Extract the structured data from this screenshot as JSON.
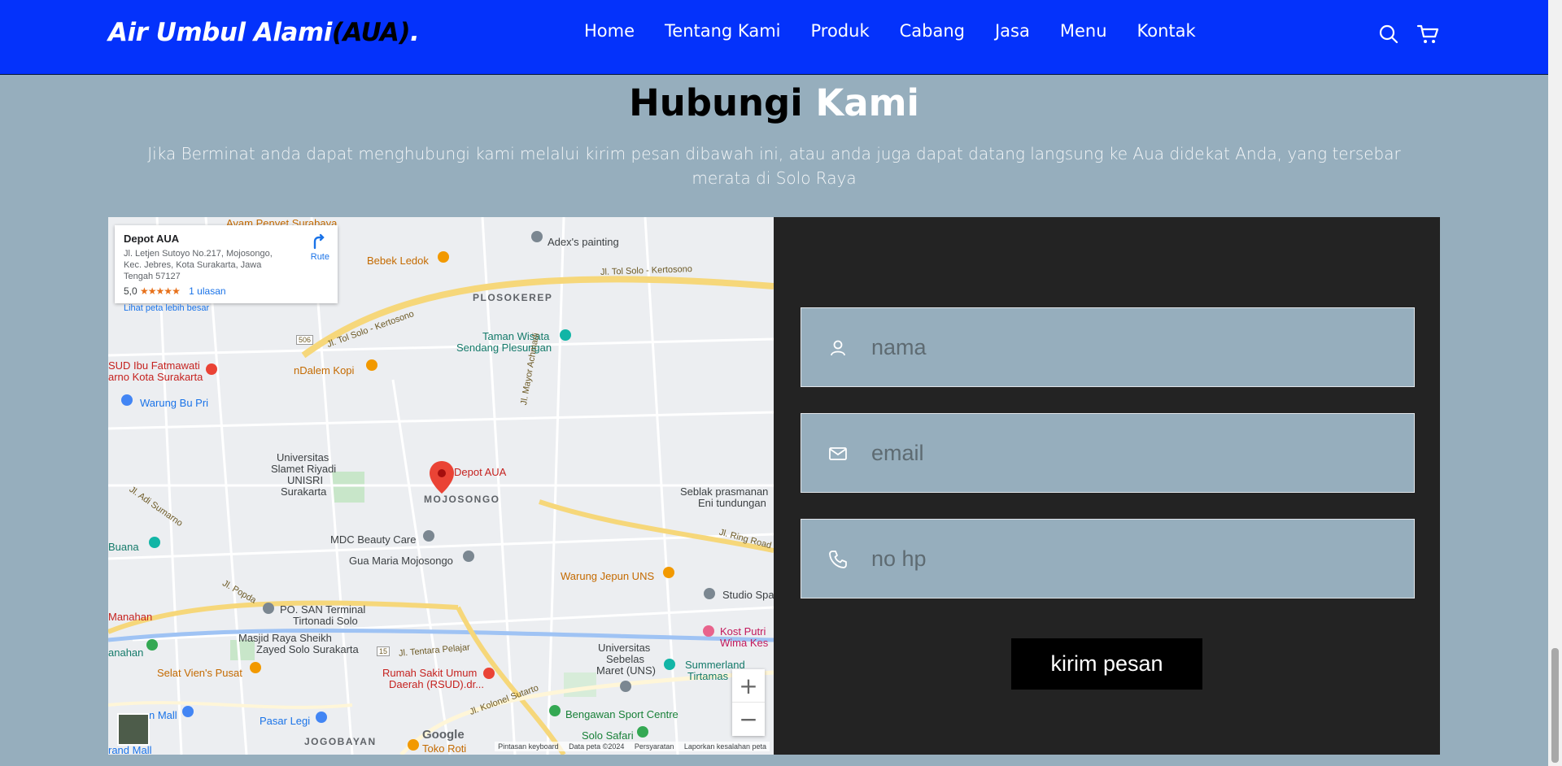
{
  "header": {
    "logo_main": "Air Umbul Alami",
    "logo_accent": "(AUA)",
    "logo_dot": ".",
    "nav": [
      "Home",
      "Tentang Kami",
      "Produk",
      "Cabang",
      "Jasa",
      "Menu",
      "Kontak"
    ],
    "icons": [
      "search-icon",
      "cart-icon"
    ]
  },
  "section": {
    "title_dark": "Hubungi",
    "title_light": "Kami",
    "description": "Jika Berminat anda dapat menghubungi kami melalui kirim pesan dibawah ini, atau anda juga dapat datang langsung ke Aua didekat Anda, yang tersebar merata di Solo Raya"
  },
  "map": {
    "place_name": "Depot AUA",
    "address": "Jl. Letjen Sutoyo No.217, Mojosongo, Kec. Jebres, Kota Surakarta, Jawa Tengah 57127",
    "rating": "5,0",
    "stars": "★★★★★",
    "reviews": "1 ulasan",
    "route_label": "Rute",
    "bigger_map": "Lihat peta lebih besar",
    "zoom_in": "+",
    "zoom_out": "−",
    "google": "Google",
    "attribution": [
      "Pintasan keyboard",
      "Data peta ©2024",
      "Persyaratan",
      "Laporkan kesalahan peta"
    ],
    "labels": {
      "ayam_penyet": "Ayam Penyet Surabaya",
      "adex": "Adex's painting",
      "bebek": "Bebek Ledok",
      "tol1": "Jl. Tol Solo - Kertosono",
      "plosokerep": "PLOSOKEREP",
      "tol2": "Jl. Tol Solo - Kertosono",
      "road506": "506",
      "taman": "Taman Wisata",
      "sendang": "Sendang Plesungan",
      "rsud_fatmawati": "SUD Ibu Fatmawati",
      "arno": "arno Kota Surakarta",
      "ndalem": "nDalem Kopi",
      "warung_bu": "Warung Bu Pri",
      "mayor": "Jl. Mayor Achmadi",
      "universitas1": "Universitas",
      "slamet": "Slamet Riyadi",
      "unisri": "UNISRI",
      "surakarta": "Surakarta",
      "depot_pin": "Depot AUA",
      "mojosongo": "MOJOSONGO",
      "seblak": "Seblak prasmanan",
      "eni": "Eni tundungan",
      "sumarno": "Jl. Adi Sumarno",
      "buana": "Buana",
      "mdc": "MDC Beauty Care",
      "gua_maria": "Gua Maria Mojosongo",
      "ring": "Jl. Ring Road",
      "warung_jepun": "Warung Jepun UNS",
      "studio": "Studio Spa",
      "popda": "Jl. Popda",
      "po_san": "PO. SAN Terminal",
      "tirtonadi": "Tirtonadi Solo",
      "manahan": "Manahan",
      "masjid": "Masjid Raya Sheikh",
      "zayed": "Zayed Solo Surakarta",
      "road15": "15",
      "tentara": "Jl. Tentara Pelajar",
      "universitas2": "Universitas",
      "sebelas": "Sebelas",
      "maret": "Maret (UNS)",
      "kost": "Kost Putri",
      "wima": "Wima Kes",
      "summerland": "Summerland",
      "tirtamas": "Tirtamas",
      "nahan": "anahan",
      "selat": "Selat Vien's Pusat",
      "rumah_sakit": "Rumah Sakit Umum",
      "daerah": "Daerah (RSUD).dr...",
      "kolonel": "Jl. Kolonel Sutarto",
      "bengawan": "Bengawan Sport Centre",
      "mall": "n Mall",
      "pasar": "Pasar Legi",
      "jogobayan": "JOGOBAYAN",
      "toko": "Toko Roti",
      "solo_safari": "Solo Safari",
      "grand": "rand Mall"
    }
  },
  "form": {
    "name_placeholder": "nama",
    "email_placeholder": "email",
    "phone_placeholder": "no hp",
    "submit_label": "kirim pesan"
  },
  "colors": {
    "header_bg": "#0432fb",
    "page_bg": "#96aebd",
    "form_bg": "#232323",
    "button_bg": "#000000"
  }
}
